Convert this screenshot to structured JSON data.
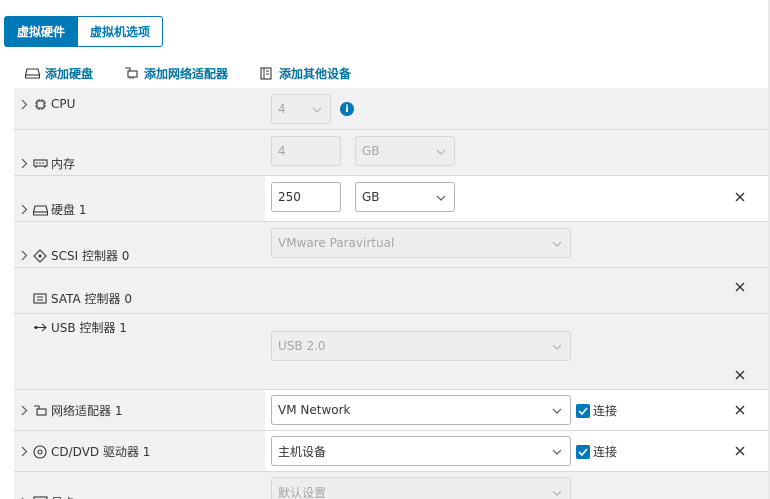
{
  "tabs": {
    "hardware": "虚拟硬件",
    "options": "虚拟机选项"
  },
  "actions": {
    "add_disk": "添加硬盘",
    "add_nic": "添加网络适配器",
    "add_other": "添加其他设备"
  },
  "rows": {
    "cpu": {
      "label": "CPU",
      "value": "4"
    },
    "memory": {
      "label": "内存",
      "value": "4",
      "unit": "GB"
    },
    "disk": {
      "label": "硬盘 1",
      "value": "250",
      "unit": "GB"
    },
    "scsi": {
      "label": "SCSI 控制器 0",
      "value": "VMware Paravirtual"
    },
    "sata": {
      "label": "SATA 控制器 0"
    },
    "usb": {
      "label": "USB 控制器 1",
      "value": "USB 2.0"
    },
    "nic": {
      "label": "网络适配器 1",
      "value": "VM Network",
      "connect": "连接"
    },
    "cdrom": {
      "label": "CD/DVD 驱动器 1",
      "value": "主机设备",
      "connect": "连接"
    },
    "display": {
      "label": "显卡",
      "value": "默认设置"
    }
  },
  "colors": {
    "accent": "#0079b8",
    "link": "#0072a3",
    "row_bg": "#f1f1f1"
  }
}
